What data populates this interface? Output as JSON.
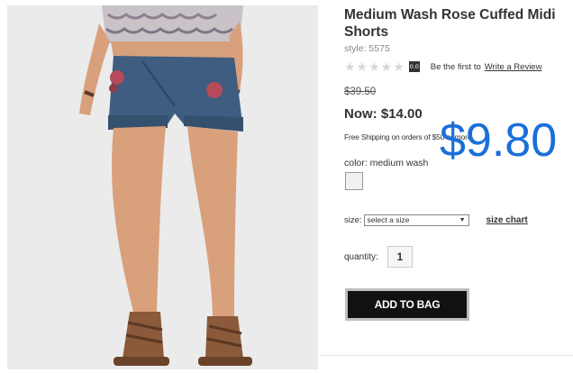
{
  "product": {
    "image_alt": "Model wearing medium wash rose cuffed midi shorts with lace-up sandals",
    "title": "Medium Wash Rose Cuffed Midi Shorts",
    "style_text": "style: 5575",
    "rating": {
      "stars": "★★★★★",
      "score": "0.0",
      "first_text": "Be the first to",
      "review_link": "Write a Review"
    },
    "old_price": "$39.50",
    "now_price": "Now: $14.00",
    "shipping_text": "Free Shipping on orders of $50 or more.",
    "overlay_price": "$9.80",
    "color_label": "color: medium wash",
    "size_label": "size:",
    "size_select_value": "select a size",
    "size_chart_link": "size chart",
    "quantity_label": "quantity:",
    "quantity_value": "1",
    "add_to_bag_label": "ADD TO BAG"
  },
  "colors": {
    "overlay_price": "#1a6fd8",
    "button_bg": "#111111",
    "swatch": "#f1f1f1"
  }
}
